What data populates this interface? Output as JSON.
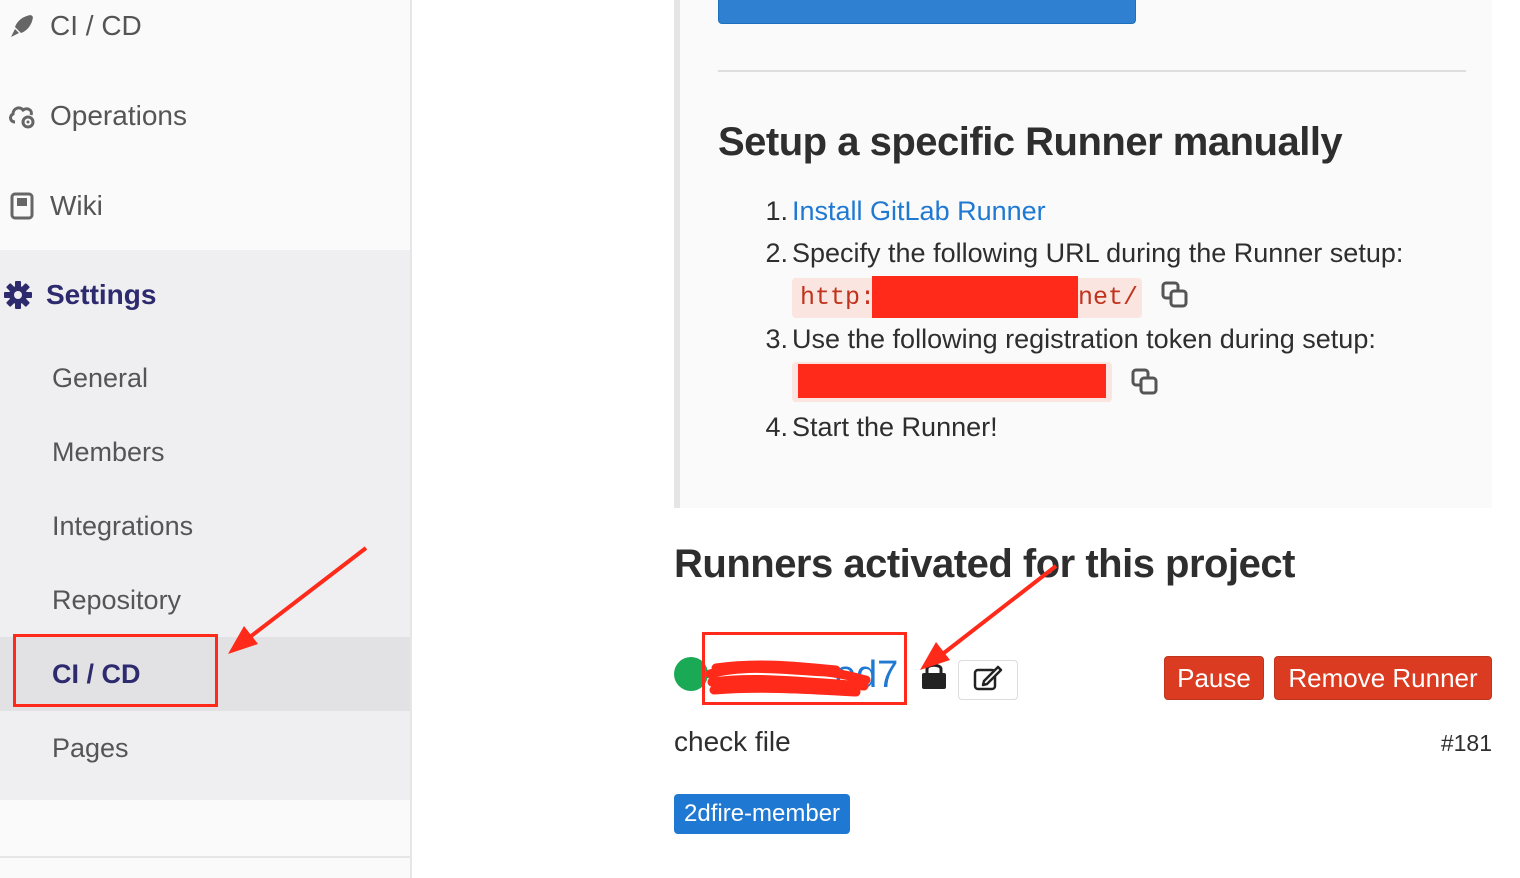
{
  "sidebar": {
    "top_items": [
      {
        "label": "CI / CD",
        "icon": "rocket-icon"
      },
      {
        "label": "Operations",
        "icon": "cloud-gear-icon"
      },
      {
        "label": "Wiki",
        "icon": "book-icon"
      }
    ],
    "settings": {
      "label": "Settings",
      "icon": "gear-icon",
      "items": [
        {
          "label": "General"
        },
        {
          "label": "Members"
        },
        {
          "label": "Integrations"
        },
        {
          "label": "Repository"
        },
        {
          "label": "CI / CD",
          "active": true
        },
        {
          "label": "Pages"
        }
      ]
    }
  },
  "setup": {
    "title": "Setup a specific Runner manually",
    "steps": [
      {
        "num": "1.",
        "text": "Install GitLab Runner",
        "is_link": true
      },
      {
        "num": "2.",
        "text": "Specify the following URL during the Runner setup:"
      },
      {
        "num": "3.",
        "text": "Use the following registration token during setup:"
      },
      {
        "num": "4.",
        "text": "Start the Runner!"
      }
    ],
    "url_prefix": "http:",
    "url_suffix": "net/"
  },
  "runners": {
    "title": "Runners activated for this project",
    "runner": {
      "token_visible": "ed7",
      "description": "check file",
      "id": "#181",
      "tag": "2dfire-member",
      "status": "active",
      "pause_label": "Pause",
      "remove_label": "Remove Runner"
    }
  },
  "colors": {
    "accent": "#1f78d1",
    "danger": "#db3b21",
    "success": "#1aaa55",
    "annotation": "#ff2a1a",
    "nav_active": "#2d2a6e"
  }
}
